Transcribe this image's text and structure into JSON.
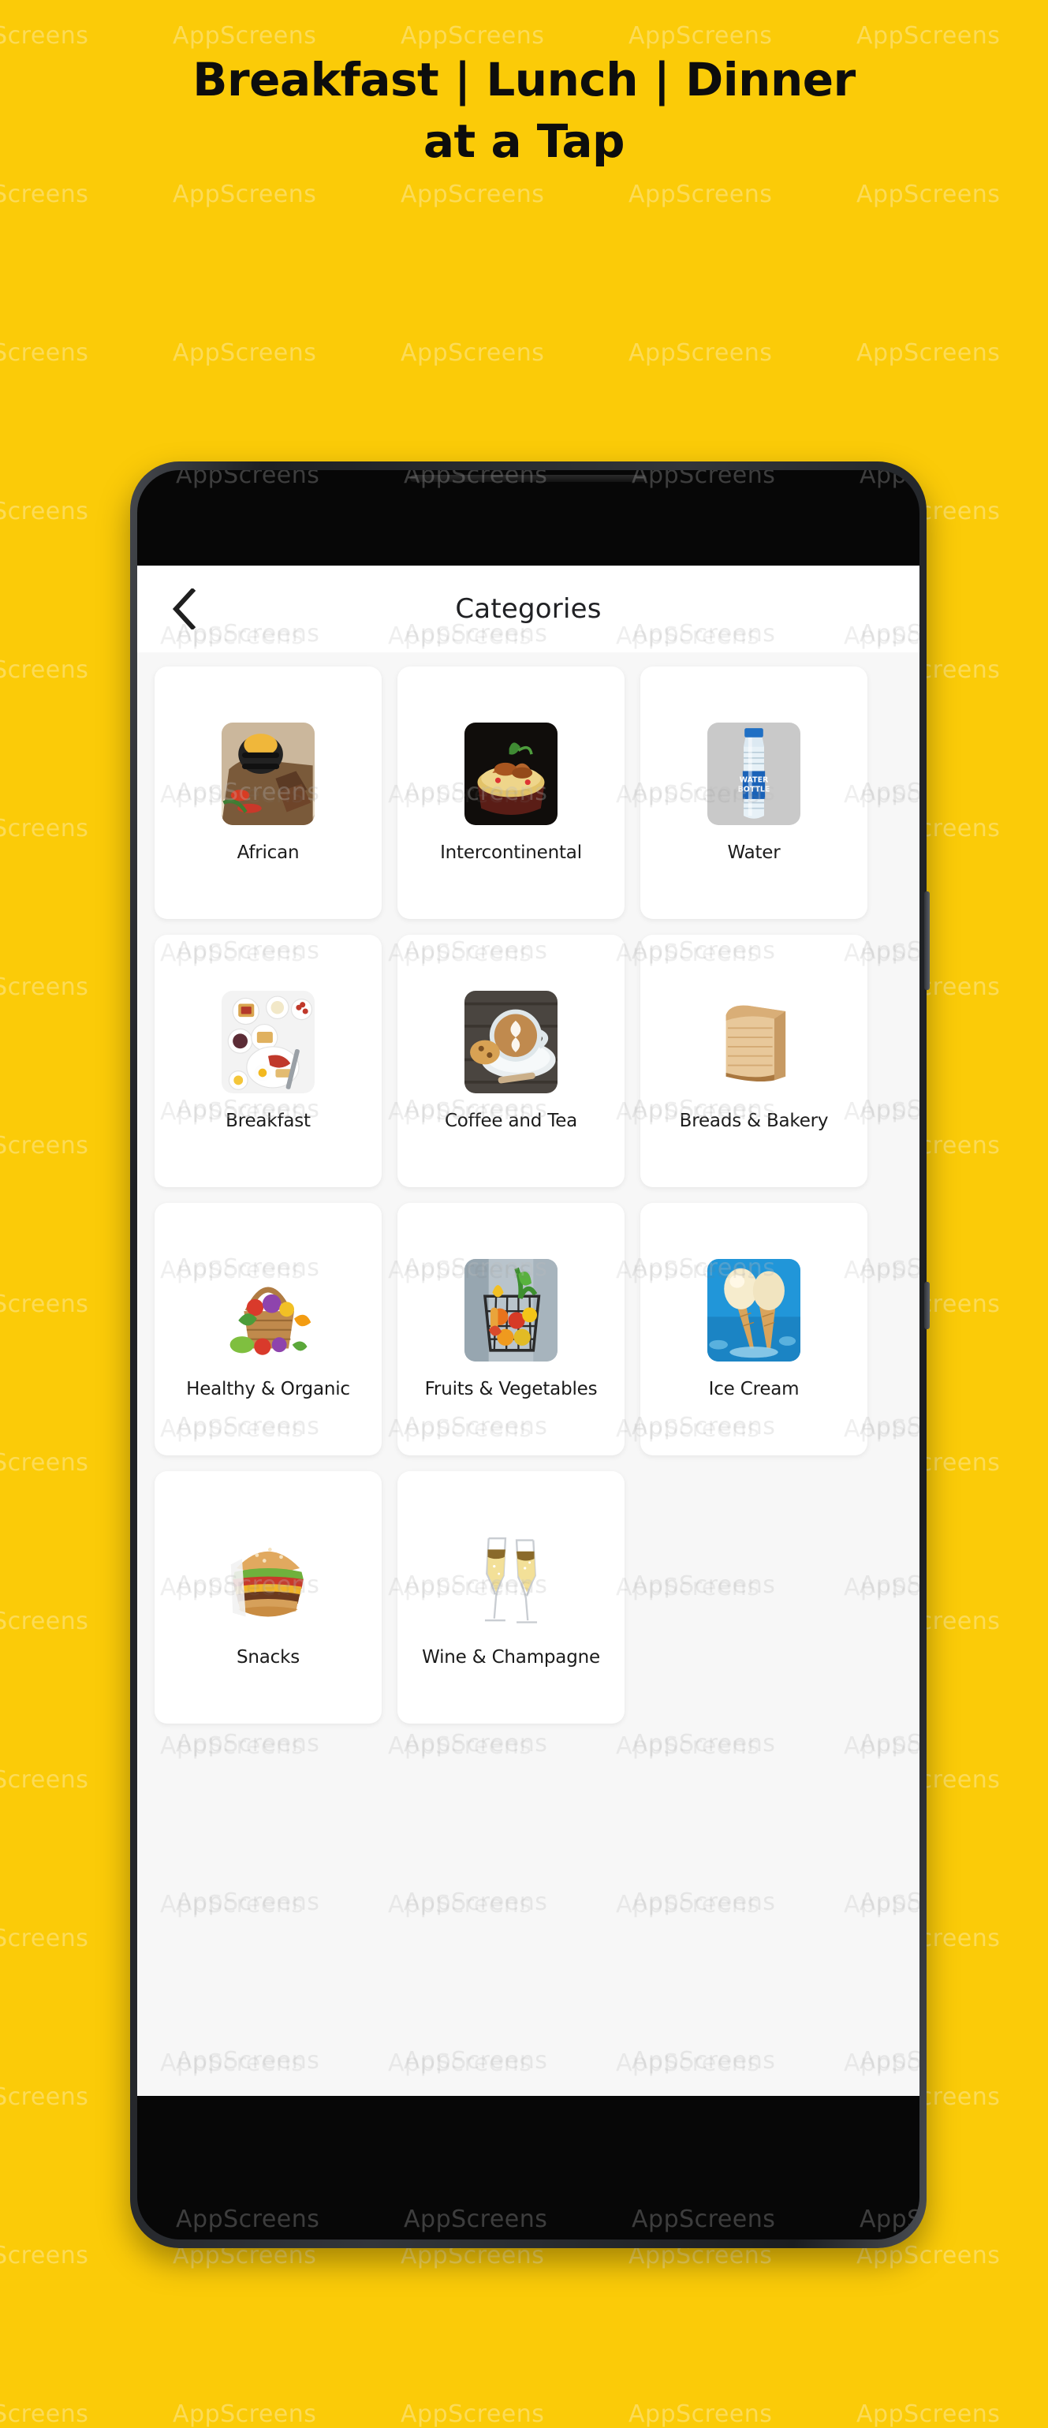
{
  "theme": {
    "background_color": "#FBCB08",
    "headline_color": "#0D0D0D",
    "screen_background": "#F7F7F7",
    "card_background": "#FFFFFF",
    "appbar_background": "#FFFFFF",
    "label_color": "#1B1B1B"
  },
  "watermark": {
    "text": "AppScreens"
  },
  "headline": {
    "line1": "Breakfast | Lunch | Dinner",
    "line2": "at a Tap"
  },
  "phone": {
    "appbar": {
      "back_icon": "chevron-left-icon",
      "title": "Categories"
    },
    "categories": [
      {
        "label": "African",
        "icon": "african-food-icon"
      },
      {
        "label": "Intercontinental",
        "icon": "intercontinental-food-icon"
      },
      {
        "label": "Water",
        "icon": "water-bottle-icon"
      },
      {
        "label": "Breakfast",
        "icon": "breakfast-plate-icon"
      },
      {
        "label": "Coffee and Tea",
        "icon": "coffee-cup-icon"
      },
      {
        "label": "Breads & Bakery",
        "icon": "bread-loaf-icon"
      },
      {
        "label": "Healthy & Organic",
        "icon": "vegetable-basket-icon"
      },
      {
        "label": "Fruits & Vegetables",
        "icon": "fruit-basket-icon"
      },
      {
        "label": "Ice Cream",
        "icon": "ice-cream-cone-icon"
      },
      {
        "label": "Snacks",
        "icon": "burger-icon"
      },
      {
        "label": "Wine & Champagne",
        "icon": "champagne-glasses-icon"
      }
    ]
  }
}
